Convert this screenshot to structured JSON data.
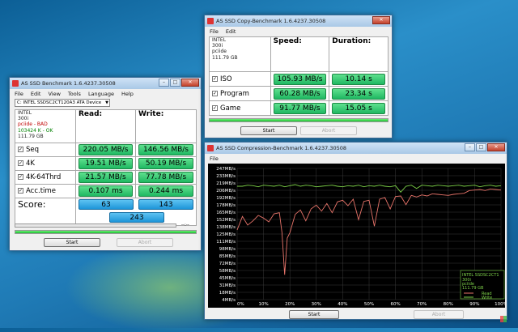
{
  "bench": {
    "title": "AS SSD Benchmark 1.6.4237.30508",
    "menu": [
      "File",
      "Edit",
      "View",
      "Tools",
      "Language",
      "Help"
    ],
    "drive_select": "C: INTEL SSDSC2CT120A3 ATA Device",
    "info": [
      "INTEL",
      "300i",
      "pciide - BAD",
      "103424 K - OK",
      "111.79 GB"
    ],
    "read_header": "Read:",
    "write_header": "Write:",
    "rows": [
      {
        "label": "Seq",
        "read": "220.05 MB/s",
        "write": "146.56 MB/s"
      },
      {
        "label": "4K",
        "read": "19.51 MB/s",
        "write": "50.19 MB/s"
      },
      {
        "label": "4K-64Thrd",
        "read": "21.57 MB/s",
        "write": "77.78 MB/s"
      },
      {
        "label": "Acc.time",
        "read": "0.107 ms",
        "write": "0.244 ms"
      }
    ],
    "score_label": "Score:",
    "score_read": "63",
    "score_write": "143",
    "score_total": "243",
    "progress_time": "--:--",
    "start": "Start",
    "abort": "Abort"
  },
  "copy": {
    "title": "AS SSD Copy-Benchmark 1.6.4237.30508",
    "menu": [
      "File",
      "Edit"
    ],
    "info": [
      "INTEL",
      "300i",
      "pciide",
      "111.79 GB"
    ],
    "speed_header": "Speed:",
    "duration_header": "Duration:",
    "rows": [
      {
        "label": "ISO",
        "speed": "105.93 MB/s",
        "duration": "10.14 s"
      },
      {
        "label": "Program",
        "speed": "60.28 MB/s",
        "duration": "23.34 s"
      },
      {
        "label": "Game",
        "speed": "91.77 MB/s",
        "duration": "15.05 s"
      }
    ],
    "start": "Start",
    "abort": "Abort"
  },
  "compress": {
    "title": "AS SSD Compression-Benchmark 1.6.4237.30508",
    "menu": [
      "File"
    ],
    "legend_info": [
      "INTEL SSDSC2CT1",
      "300i",
      "pciide",
      "111.79 GB"
    ],
    "legend_read": "Read",
    "legend_write": "Write",
    "start": "Start",
    "abort": "Abort",
    "colors": {
      "read": "#e8746a",
      "write": "#7fd44a",
      "background": "#000000",
      "grid": "#3a3a3a"
    }
  },
  "chart_data": {
    "type": "line",
    "yticks": [
      "247MB/s",
      "233MB/s",
      "219MB/s",
      "206MB/s",
      "192MB/s",
      "178MB/s",
      "165MB/s",
      "152MB/s",
      "138MB/s",
      "125MB/s",
      "111MB/s",
      "98MB/s",
      "85MB/s",
      "72MB/s",
      "58MB/s",
      "45MB/s",
      "31MB/s",
      "18MB/s",
      "4MB/s"
    ],
    "xticks": [
      "0%",
      "10%",
      "20%",
      "30%",
      "40%",
      "50%",
      "60%",
      "70%",
      "80%",
      "90%",
      "100%"
    ],
    "ylim": [
      4,
      247
    ],
    "xlim": [
      0,
      100
    ],
    "grid": true,
    "legend_position": "bottom-right",
    "series": [
      {
        "name": "Read",
        "x": [
          0,
          2,
          4,
          6,
          8,
          10,
          12,
          14,
          16,
          17,
          18,
          19,
          20,
          22,
          24,
          26,
          28,
          30,
          32,
          34,
          36,
          38,
          40,
          42,
          44,
          46,
          48,
          50,
          52,
          54,
          56,
          58,
          60,
          62,
          64,
          66,
          68,
          70,
          72,
          74,
          76,
          78,
          80,
          82,
          84,
          86,
          88,
          90,
          92,
          94,
          96,
          98,
          100
        ],
        "y": [
          133,
          158,
          142,
          150,
          160,
          155,
          148,
          163,
          165,
          128,
          50,
          118,
          128,
          162,
          170,
          150,
          172,
          179,
          168,
          182,
          165,
          185,
          188,
          178,
          190,
          152,
          186,
          188,
          140,
          190,
          193,
          172,
          195,
          196,
          180,
          197,
          194,
          198,
          196,
          200,
          199,
          198,
          197,
          199,
          200,
          201,
          206,
          207,
          208,
          206,
          209,
          208,
          207
        ]
      },
      {
        "name": "Write",
        "x": [
          0,
          2,
          4,
          6,
          8,
          10,
          12,
          14,
          16,
          18,
          20,
          22,
          24,
          26,
          28,
          30,
          32,
          34,
          36,
          38,
          40,
          42,
          44,
          46,
          48,
          50,
          52,
          54,
          56,
          58,
          60,
          62,
          64,
          66,
          68,
          70,
          72,
          74,
          76,
          78,
          80,
          82,
          84,
          86,
          88,
          90,
          92,
          94,
          96,
          98,
          100
        ],
        "y": [
          214,
          214,
          216,
          215,
          213,
          216,
          215,
          214,
          216,
          213,
          215,
          217,
          214,
          216,
          215,
          213,
          214,
          215,
          216,
          214,
          213,
          215,
          214,
          216,
          213,
          215,
          214,
          216,
          214,
          213,
          215,
          203,
          214,
          216,
          210,
          216,
          215,
          214,
          216,
          215,
          214,
          215,
          216,
          214,
          215,
          216,
          213,
          215,
          216,
          214,
          215
        ]
      }
    ]
  }
}
